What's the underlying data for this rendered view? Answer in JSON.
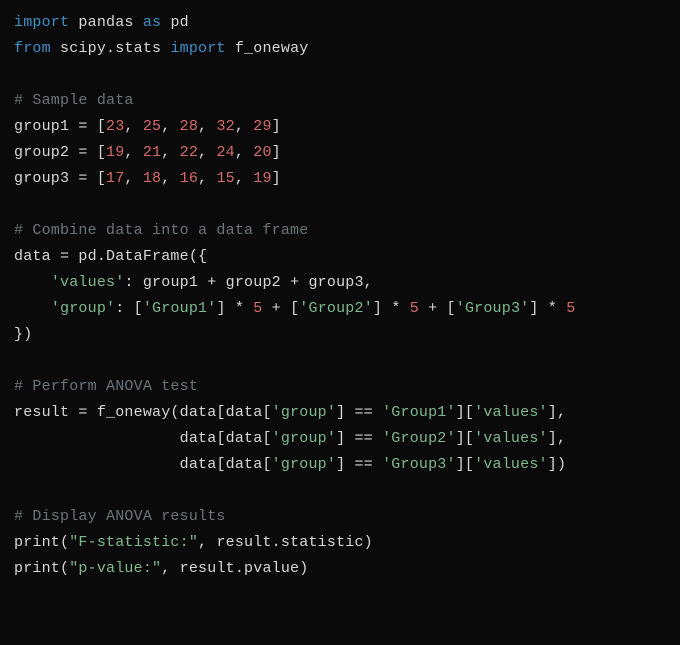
{
  "code": {
    "import1_kw1": "import",
    "import1_mod": "pandas",
    "import1_kw2": "as",
    "import1_alias": "pd",
    "import2_kw1": "from",
    "import2_mod": "scipy.stats",
    "import2_kw2": "import",
    "import2_name": "f_oneway",
    "cmt_sample": "# Sample data",
    "g1_lhs": "group1 = [",
    "g1_n1": "23",
    "g1_c1": ", ",
    "g1_n2": "25",
    "g1_c2": ", ",
    "g1_n3": "28",
    "g1_c3": ", ",
    "g1_n4": "32",
    "g1_c4": ", ",
    "g1_n5": "29",
    "g1_end": "]",
    "g2_lhs": "group2 = [",
    "g2_n1": "19",
    "g2_c1": ", ",
    "g2_n2": "21",
    "g2_c2": ", ",
    "g2_n3": "22",
    "g2_c3": ", ",
    "g2_n4": "24",
    "g2_c4": ", ",
    "g2_n5": "20",
    "g2_end": "]",
    "g3_lhs": "group3 = [",
    "g3_n1": "17",
    "g3_c1": ", ",
    "g3_n2": "18",
    "g3_c2": ", ",
    "g3_n3": "16",
    "g3_c3": ", ",
    "g3_n4": "15",
    "g3_c4": ", ",
    "g3_n5": "19",
    "g3_end": "]",
    "cmt_combine": "# Combine data into a data frame",
    "df_line": "data = pd.DataFrame({",
    "df_values_indent": "    ",
    "df_values_key": "'values'",
    "df_values_rest": ": group1 + group2 + group3,",
    "df_group_indent": "    ",
    "df_group_key": "'group'",
    "df_group_mid1": ": [",
    "df_group_s1": "'Group1'",
    "df_group_mid2": "] * ",
    "df_group_n1": "5",
    "df_group_mid3": " + [",
    "df_group_s2": "'Group2'",
    "df_group_mid4": "] * ",
    "df_group_n2": "5",
    "df_group_mid5": " + [",
    "df_group_s3": "'Group3'",
    "df_group_mid6": "] * ",
    "df_group_n3": "5",
    "df_close": "})",
    "cmt_anova": "# Perform ANOVA test",
    "res_l1a": "result = f_oneway(data[data[",
    "res_l1_s1": "'group'",
    "res_l1b": "] == ",
    "res_l1_s2": "'Group1'",
    "res_l1c": "][",
    "res_l1_s3": "'values'",
    "res_l1d": "],",
    "res_l2_indent": "                  ",
    "res_l2a": "data[data[",
    "res_l2_s1": "'group'",
    "res_l2b": "] == ",
    "res_l2_s2": "'Group2'",
    "res_l2c": "][",
    "res_l2_s3": "'values'",
    "res_l2d": "],",
    "res_l3_indent": "                  ",
    "res_l3a": "data[data[",
    "res_l3_s1": "'group'",
    "res_l3b": "] == ",
    "res_l3_s2": "'Group3'",
    "res_l3c": "][",
    "res_l3_s3": "'values'",
    "res_l3d": "])",
    "cmt_display": "# Display ANOVA results",
    "print1_fn": "print",
    "print1_open": "(",
    "print1_str": "\"F-statistic:\"",
    "print1_rest": ", result.statistic)",
    "print2_fn": "print",
    "print2_open": "(",
    "print2_str": "\"p-value:\"",
    "print2_rest": ", result.pvalue)"
  }
}
